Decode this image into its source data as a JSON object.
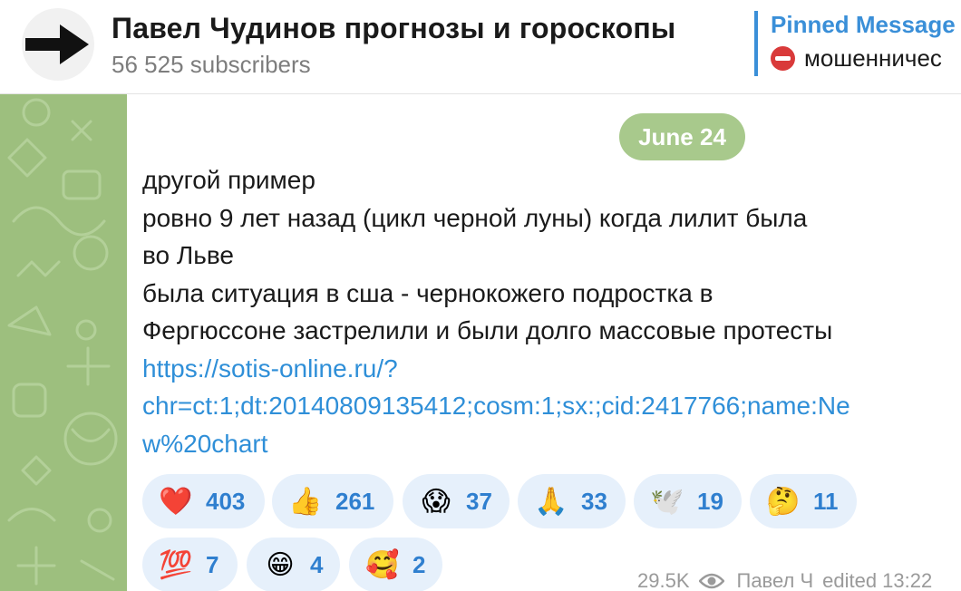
{
  "header": {
    "title": "Павел Чудинов прогнозы и гороскопы",
    "subscribers": "56 525 subscribers",
    "pinned_title": "Pinned Message",
    "pinned_text": "мошенничес"
  },
  "message": {
    "date": "June 24",
    "lines": [
      "другой пример",
      "ровно 9 лет назад (цикл черной луны) когда лилит была",
      "во Льве",
      "была ситуация в сша - чернокожего подростка в",
      "Фергюссоне застрелили и были долго массовые протесты"
    ],
    "link_lines": [
      "https://sotis-online.ru/?",
      "chr=ct:1;dt:20140809135412;cosm:1;sx:;cid:2417766;name:Ne",
      "w%20chart"
    ],
    "views": "29.5K",
    "author": "Павел Ч",
    "edited": "edited 13:22"
  },
  "reactions": [
    {
      "emoji": "❤️",
      "count": "403"
    },
    {
      "emoji": "👍",
      "count": "261"
    },
    {
      "emoji": "😱",
      "count": "37"
    },
    {
      "emoji": "🙏",
      "count": "33"
    },
    {
      "emoji": "🕊️",
      "count": "19"
    },
    {
      "emoji": "🤔",
      "count": "11"
    },
    {
      "emoji": "💯",
      "count": "7"
    },
    {
      "emoji": "😁",
      "count": "4"
    },
    {
      "emoji": "🥰",
      "count": "2"
    }
  ],
  "colors": {
    "accent": "#3a8fd8",
    "link": "#2f8fd8",
    "date_pill": "#a8c98c",
    "wallpaper": "#9dbf7e",
    "reaction_bg": "#e6f0fb"
  }
}
